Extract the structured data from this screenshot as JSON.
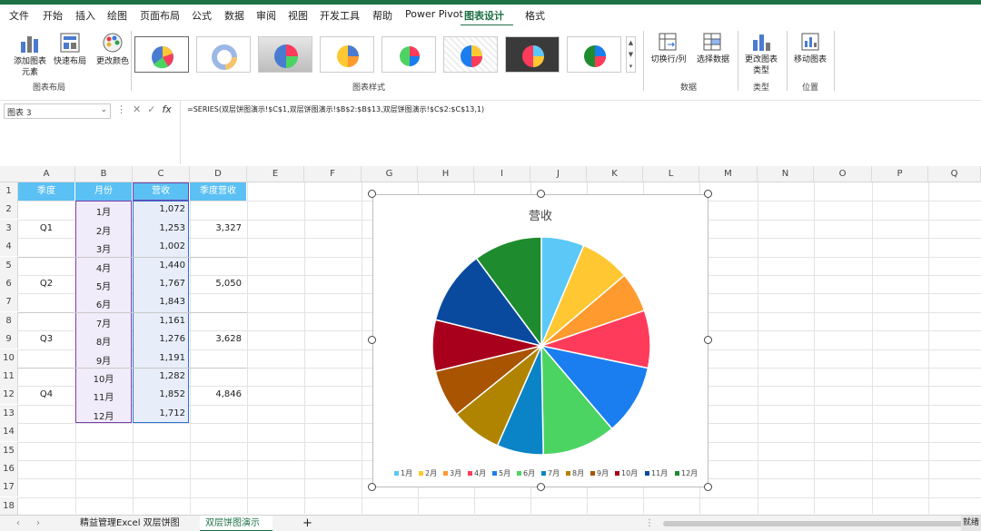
{
  "ribbon_tabs": [
    "文件",
    "开始",
    "插入",
    "绘图",
    "页面布局",
    "公式",
    "数据",
    "审阅",
    "视图",
    "开发工具",
    "帮助",
    "Power Pivot",
    "图表设计",
    "格式"
  ],
  "active_tab": "图表设计",
  "ribbon": {
    "add_element": "添加图表元素",
    "quick_layout": "快速布局",
    "change_colors": "更改颜色",
    "group_layouts": "图表布局",
    "group_styles": "图表样式",
    "switch_row_col": "切换行/列",
    "select_data": "选择数据",
    "change_type": "更改图表类型",
    "move_chart": "移动图表",
    "group_data": "数据",
    "group_type": "类型",
    "group_location": "位置"
  },
  "namebox": "图表 3",
  "formula": "=SERIES(双层饼图演示!$C$1,双层饼图演示!$B$2:$B$13,双层饼图演示!$C$2:$C$13,1)",
  "columns": [
    "A",
    "B",
    "C",
    "D",
    "E",
    "F",
    "G",
    "H",
    "I",
    "J",
    "K",
    "L",
    "M",
    "N",
    "O",
    "P",
    "Q"
  ],
  "rows": [
    "1",
    "2",
    "3",
    "4",
    "5",
    "6",
    "7",
    "8",
    "9",
    "10",
    "11",
    "12",
    "13",
    "14",
    "15",
    "16",
    "17",
    "18"
  ],
  "table": {
    "headers": [
      "季度",
      "月份",
      "营收",
      "季度营收"
    ],
    "months": [
      "1月",
      "2月",
      "3月",
      "4月",
      "5月",
      "6月",
      "7月",
      "8月",
      "9月",
      "10月",
      "11月",
      "12月"
    ],
    "revenue": [
      "1,072",
      "1,253",
      "1,002",
      "1,440",
      "1,767",
      "1,843",
      "1,161",
      "1,276",
      "1,191",
      "1,282",
      "1,852",
      "1,712"
    ],
    "quarters": [
      "Q1",
      "Q2",
      "Q3",
      "Q4"
    ],
    "quarter_revenue": [
      "3,327",
      "5,050",
      "3,628",
      "4,846"
    ]
  },
  "chart_data": {
    "type": "pie",
    "title": "营收",
    "categories": [
      "1月",
      "2月",
      "3月",
      "4月",
      "5月",
      "6月",
      "7月",
      "8月",
      "9月",
      "10月",
      "11月",
      "12月"
    ],
    "values": [
      1072,
      1253,
      1002,
      1440,
      1767,
      1843,
      1161,
      1276,
      1191,
      1282,
      1852,
      1712
    ],
    "colors": [
      "#5bc8f7",
      "#ffc832",
      "#ff9a2e",
      "#ff3b5c",
      "#1a7ef0",
      "#4cd463",
      "#0a84c6",
      "#b08400",
      "#a85400",
      "#a8001c",
      "#0a4a9e",
      "#1e8c2e"
    ],
    "legend": "bottom"
  },
  "sheet_tabs": [
    "精益管理Excel 双层饼图",
    "双层饼图演示"
  ],
  "active_sheet": "双层饼图演示",
  "status": "就绪"
}
